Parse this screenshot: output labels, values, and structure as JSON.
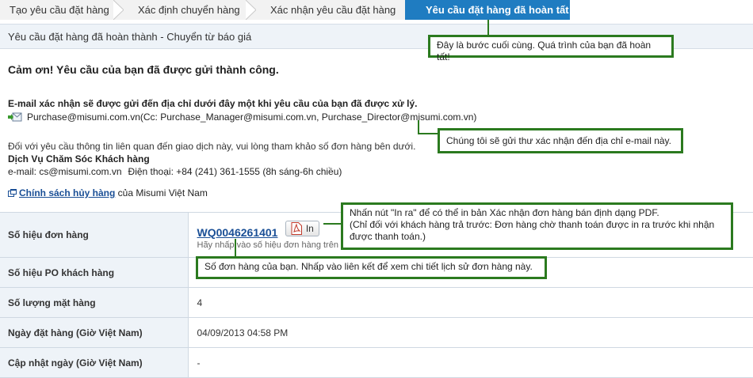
{
  "steps": [
    {
      "label": "Tạo yêu cầu đặt hàng",
      "active": false
    },
    {
      "label": "Xác định chuyển hàng",
      "active": false
    },
    {
      "label": "Xác nhận yêu cầu đặt hàng",
      "active": false
    },
    {
      "label": "Yêu cầu đặt hàng đã hoàn tất",
      "active": true
    }
  ],
  "page_title": "Yêu cầu đặt hàng đã hoàn thành - Chuyển từ báo giá",
  "thanks": "Cảm ơn! Yêu cầu của bạn đã được gửi thành công.",
  "email": {
    "info": "E-mail xác nhận sẽ được gửi đến địa chỉ dưới đây một khi yêu cầu của bạn đã được xử lý.",
    "addresses": "Purchase@misumi.com.vn(Cc: Purchase_Manager@misumi.com.vn, Purchase_Director@misumi.com.vn)"
  },
  "customer_service": {
    "inquiry": "Đối với yêu cầu thông tin liên quan đến giao dịch này, vui lòng tham khảo số đơn hàng bên dưới.",
    "title": "Dịch Vụ Chăm Sóc Khách hàng",
    "email": "e-mail: cs@misumi.com.vn",
    "phone": "Điện thoại: +84 (241) 361-1555 (8h sáng-6h chiều)"
  },
  "cancel_policy": {
    "link": "Chính sách hủy hàng",
    "suffix": " của Misumi Việt Nam"
  },
  "order": {
    "rows": [
      {
        "label": "Số hiệu đơn hàng",
        "value": "WQ0046261401"
      },
      {
        "label": "Số hiệu PO khách hàng",
        "value": ""
      },
      {
        "label": "Số lượng mặt hàng",
        "value": "4"
      },
      {
        "label": "Ngày đặt hàng (Giờ Việt Nam)",
        "value": "04/09/2013 04:58 PM"
      },
      {
        "label": "Cập nhật ngày (Giờ Việt Nam)",
        "value": "-"
      }
    ],
    "print_button": "In",
    "hint": "Hãy nhấp vào số hiệu đơn hàng trên đ"
  },
  "callouts": {
    "final_step": "Đây là bước cuối cùng. Quá trình của bạn đã hoàn tất!",
    "email_notice": "Chúng tôi sẽ gửi thư xác nhận đến địa chỉ e-mail này.",
    "print_line1": "Nhấn nút \"In ra\" để có thể in bản Xác nhận đơn hàng bán định dạng PDF.",
    "print_line2": "(Chỉ đối với khách hàng trả trước: Đơn hàng chờ thanh toán được in ra trước khi nhận được thanh toán.)",
    "order_number": "Số đơn hàng của bạn. Nhấp vào liên kết để xem chi tiết lịch sử đơn hàng này."
  },
  "colors": {
    "active_step": "#1f7cc1",
    "callout_border": "#2b7a1f",
    "link": "#1a4f96"
  }
}
